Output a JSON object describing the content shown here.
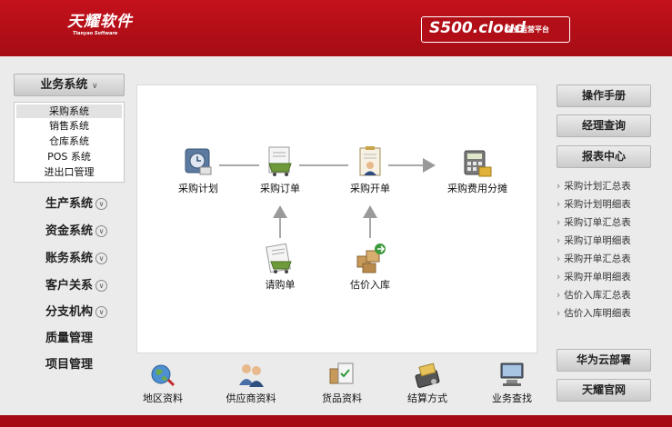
{
  "header": {
    "logo_cn": "天耀软件",
    "logo_en": "Tianyao Software",
    "product_name": "S500.cloud",
    "product_tagline": "企业运营平台"
  },
  "sidebar": {
    "active_system": "业务系统",
    "sub_items": [
      "采购系统",
      "销售系统",
      "仓库系统",
      "POS 系统",
      "进出口管理"
    ],
    "selected_sub_item": "采购系统",
    "menus": [
      {
        "label": "生产系统",
        "expandable": true
      },
      {
        "label": "资金系统",
        "expandable": true
      },
      {
        "label": "账务系统",
        "expandable": true
      },
      {
        "label": "客户关系",
        "expandable": true
      },
      {
        "label": "分支机构",
        "expandable": true
      },
      {
        "label": "质量管理",
        "expandable": false
      },
      {
        "label": "项目管理",
        "expandable": false
      }
    ]
  },
  "flow": {
    "nodes": [
      "采购计划",
      "采购订单",
      "采购开单",
      "采购费用分摊",
      "请购单",
      "估价入库"
    ]
  },
  "shortcuts": [
    "地区资料",
    "供应商资料",
    "货品资料",
    "结算方式",
    "业务查找"
  ],
  "right": {
    "top_buttons": [
      "操作手册",
      "经理查询",
      "报表中心"
    ],
    "reports": [
      "采购计划汇总表",
      "采购计划明细表",
      "采购订单汇总表",
      "采购订单明细表",
      "采购开单汇总表",
      "采购开单明细表",
      "估价入库汇总表",
      "估价入库明细表"
    ],
    "bottom_buttons": [
      "华为云部署",
      "天耀官网"
    ]
  },
  "colors": {
    "brand_red": "#b20e17",
    "page_bg": "#ebebeb"
  }
}
